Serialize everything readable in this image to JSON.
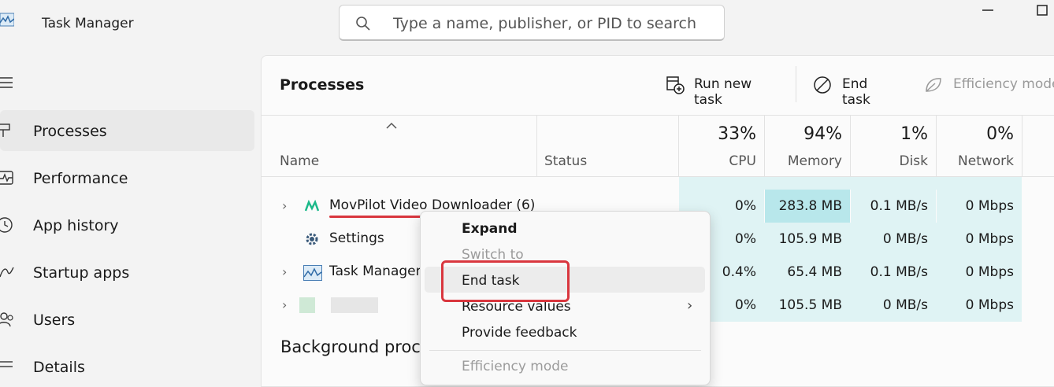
{
  "app": {
    "title": "Task Manager"
  },
  "search": {
    "placeholder": "Type a name, publisher, or PID to search"
  },
  "sidebar": {
    "items": [
      {
        "label": "Processes",
        "icon": "processes-icon",
        "active": true
      },
      {
        "label": "Performance",
        "icon": "performance-icon"
      },
      {
        "label": "App history",
        "icon": "app-history-icon"
      },
      {
        "label": "Startup apps",
        "icon": "startup-apps-icon"
      },
      {
        "label": "Users",
        "icon": "users-icon"
      },
      {
        "label": "Details",
        "icon": "details-icon"
      }
    ]
  },
  "toolbar": {
    "title": "Processes",
    "run_new_task": "Run new task",
    "end_task": "End task",
    "efficiency_mode": "Efficiency mode"
  },
  "columns": {
    "name": "Name",
    "status": "Status",
    "cpu": {
      "pct": "33%",
      "label": "CPU"
    },
    "memory": {
      "pct": "94%",
      "label": "Memory"
    },
    "disk": {
      "pct": "1%",
      "label": "Disk"
    },
    "network": {
      "pct": "0%",
      "label": "Network"
    }
  },
  "rows": [
    {
      "name": "MovPilot Video Downloader (6)",
      "cpu": "0%",
      "memory": "283.8 MB",
      "disk": "0.1 MB/s",
      "network": "0 Mbps"
    },
    {
      "name": "Settings",
      "cpu": "0%",
      "memory": "105.9 MB",
      "disk": "0 MB/s",
      "network": "0 Mbps"
    },
    {
      "name": "Task Manager",
      "cpu": "0.4%",
      "memory": "65.4 MB",
      "disk": "0.1 MB/s",
      "network": "0 Mbps"
    },
    {
      "name": "",
      "cpu": "0%",
      "memory": "105.5 MB",
      "disk": "0 MB/s",
      "network": "0 Mbps"
    }
  ],
  "section": {
    "background": "Background proc"
  },
  "context_menu": {
    "items": [
      {
        "label": "Expand",
        "bold": true
      },
      {
        "label": "Switch to",
        "disabled": true
      },
      {
        "label": "End task",
        "highlighted": true
      },
      {
        "label": "Resource values",
        "submenu": true
      },
      {
        "label": "Provide feedback"
      },
      {
        "label": "Efficiency mode",
        "disabled": true
      }
    ]
  },
  "colors": {
    "accent_highlight": "#d9363e",
    "heat_light": "#dff3f4",
    "heat_strong": "#b8e7eb"
  }
}
